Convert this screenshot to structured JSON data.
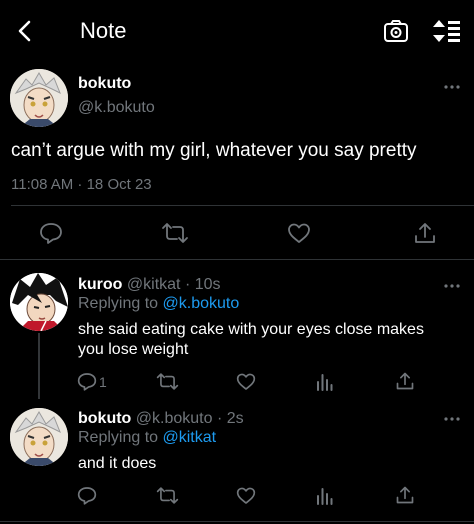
{
  "header": {
    "title": "Note"
  },
  "main_tweet": {
    "display_name": "bokuto",
    "handle": "@k.bokuto",
    "text": "can’t argue with my girl, whatever you say pretty",
    "timestamp": "11:08 AM · 18 Oct 23"
  },
  "reply1": {
    "display_name": "kuroo",
    "handle": "@kitkat",
    "time": "· 10s",
    "replying_prefix": "Replying to",
    "replying_to": "@k.bokuto",
    "text_line1": "she said eating cake with your eyes close makes",
    "text_line2": "you lose weight",
    "reply_count": "1"
  },
  "reply2": {
    "display_name": "bokuto",
    "handle": "@k.bokuto",
    "time": "· 2s",
    "replying_prefix": "Replying to",
    "replying_to": "@kitkat",
    "text": "and it does"
  },
  "colors": {
    "background": "#000000",
    "muted": "#71767b",
    "link": "#1d9bf0",
    "divider": "#2f3336"
  }
}
